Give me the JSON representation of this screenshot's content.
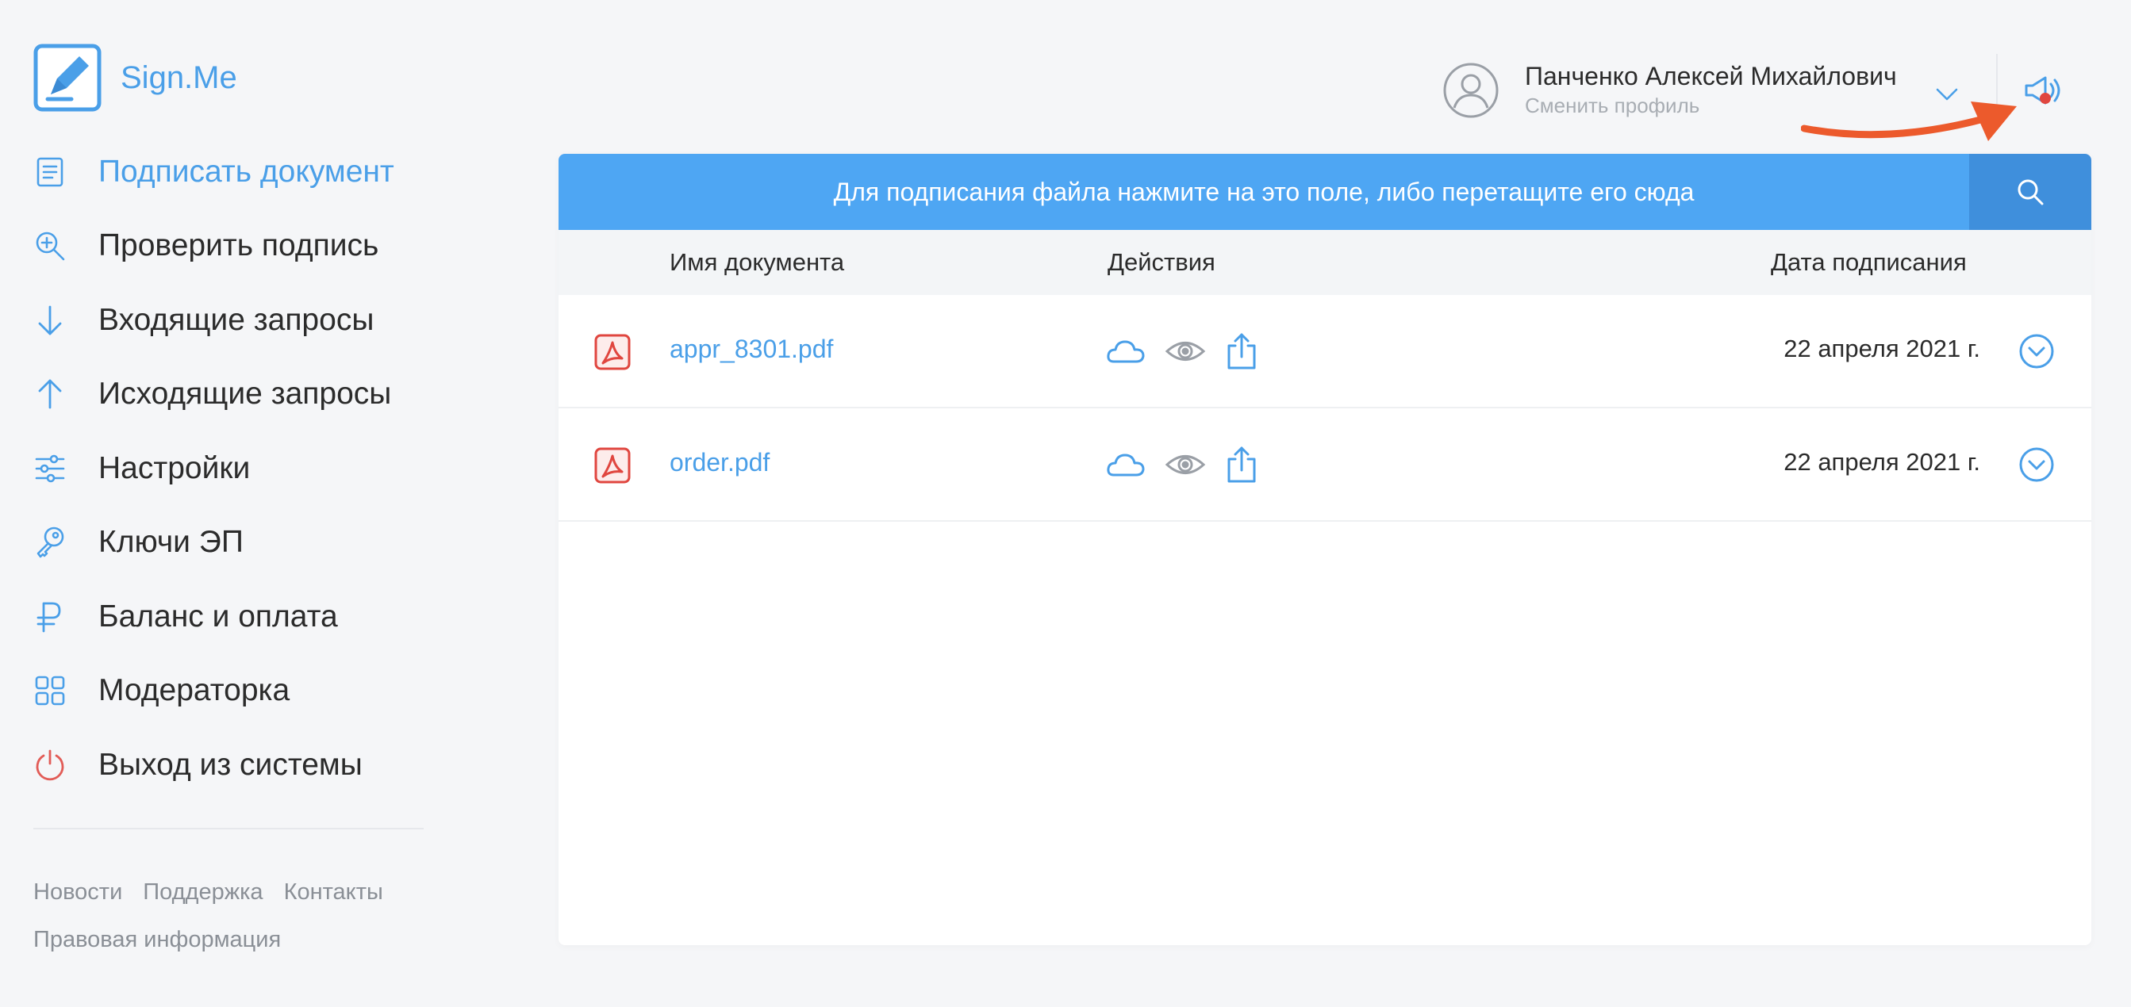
{
  "app": {
    "name": "Sign.Me"
  },
  "nav": {
    "items": [
      {
        "label": "Подписать документ",
        "icon": "document-lines-icon",
        "active": true
      },
      {
        "label": "Проверить подпись",
        "icon": "magnifier-plus-icon",
        "active": false
      },
      {
        "label": "Входящие запросы",
        "icon": "arrow-down-icon",
        "active": false
      },
      {
        "label": "Исходящие запросы",
        "icon": "arrow-up-icon",
        "active": false
      },
      {
        "label": "Настройки",
        "icon": "sliders-icon",
        "active": false
      },
      {
        "label": "Ключи ЭП",
        "icon": "key-icon",
        "active": false
      },
      {
        "label": "Баланс и оплата",
        "icon": "ruble-icon",
        "active": false
      },
      {
        "label": "Модераторка",
        "icon": "grid-icon",
        "active": false
      },
      {
        "label": "Выход из системы",
        "icon": "power-icon",
        "active": false
      }
    ]
  },
  "footer": {
    "links": [
      "Новости",
      "Поддержка",
      "Контакты",
      "Правовая информация"
    ]
  },
  "profile": {
    "name": "Панченко Алексей Михайлович",
    "subtitle": "Сменить профиль",
    "notification_icon": "megaphone-icon",
    "has_notification_dot": true
  },
  "upload": {
    "prompt": "Для подписания файла нажмите на это поле, либо перетащите его сюда",
    "search_icon": "search-icon"
  },
  "table": {
    "columns": [
      "Имя документа",
      "Действия",
      "Дата подписания"
    ],
    "rows": [
      {
        "name": "appr_8301.pdf",
        "date": "22 апреля 2021 г.",
        "actions": [
          "cloud-icon",
          "eye-icon",
          "share-icon"
        ]
      },
      {
        "name": "order.pdf",
        "date": "22 апреля 2021 г.",
        "actions": [
          "cloud-icon",
          "eye-icon",
          "share-icon"
        ]
      }
    ]
  },
  "colors": {
    "accent": "#4a9fe8",
    "dropzone": "#4ea6f3",
    "search_button": "#3f8fdc",
    "pdf_red": "#e0463f",
    "power_red": "#e25c57",
    "annotation_arrow": "#ec5a2c",
    "background": "#f5f6f8"
  }
}
